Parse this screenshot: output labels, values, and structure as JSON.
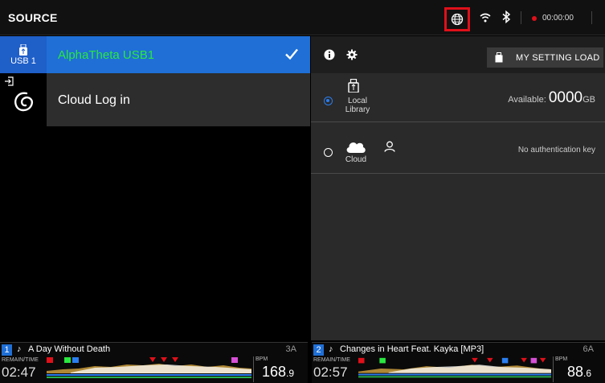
{
  "topbar": {
    "title": "SOURCE",
    "rec_time": "00:00:00",
    "icons": [
      "globe-icon",
      "wifi-icon",
      "bluetooth-icon",
      "record-dot-icon"
    ],
    "highlight_color": "#e0101a"
  },
  "sidebar": {
    "usb_label": "USB 1",
    "cloud_icon": "cloud-swirl-icon"
  },
  "sources": [
    {
      "label": "AlphaTheta USB1",
      "selected": true
    },
    {
      "label": "Cloud Log in",
      "selected": false
    }
  ],
  "panel": {
    "my_setting_load": "MY SETTING LOAD",
    "local": {
      "label_line1": "Local",
      "label_line2": "Library",
      "available_label": "Available:",
      "available_value": "0000",
      "available_unit": "GB",
      "selected": true
    },
    "cloud": {
      "label": "Cloud",
      "status": "No authentication key",
      "selected": false
    }
  },
  "decks": [
    {
      "number": "1",
      "note": "♪",
      "title": "A Day Without Death",
      "key": "3A",
      "remain_label": "REMAIN/TIME",
      "time": "02:47",
      "bpm_label": "BPM",
      "bpm_int": "168",
      "bpm_dec": ".9"
    },
    {
      "number": "2",
      "note": "♪",
      "title": "Changes in Heart Feat. Kayka [MP3]",
      "key": "6A",
      "remain_label": "REMAIN/TIME",
      "time": "02:57",
      "bpm_label": "BPM",
      "bpm_int": "88",
      "bpm_dec": ".6"
    }
  ],
  "colors": {
    "accent_blue": "#1f6fd6",
    "selected_text": "#29e840",
    "panel_bg": "#2a2a2a"
  }
}
